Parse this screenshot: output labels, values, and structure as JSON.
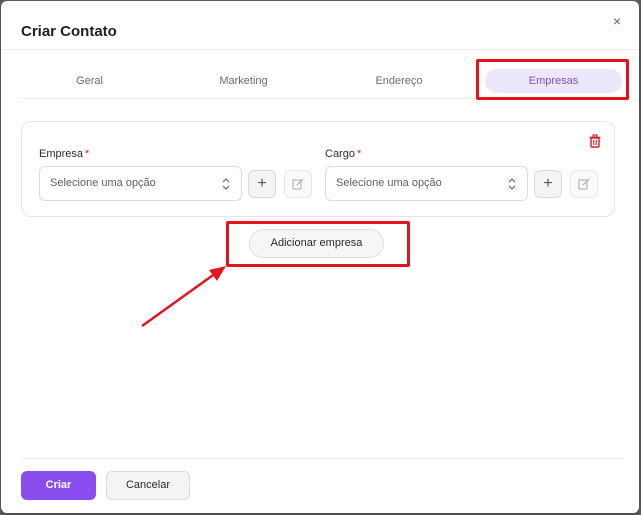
{
  "dialog": {
    "title": "Criar Contato",
    "close_symbol": "×"
  },
  "tabs": [
    {
      "label": "Geral",
      "active": false
    },
    {
      "label": "Marketing",
      "active": false
    },
    {
      "label": "Endereço",
      "active": false
    },
    {
      "label": "Empresas",
      "active": true
    }
  ],
  "company_card": {
    "empresa": {
      "label": "Empresa",
      "required_mark": "*",
      "placeholder": "Selecione uma opção"
    },
    "cargo": {
      "label": "Cargo",
      "required_mark": "*",
      "placeholder": "Selecione uma opção"
    },
    "add_symbol": "+",
    "icons": {
      "delete": "trash-icon",
      "edit": "edit-icon",
      "select": "chevron-up-down-icon"
    }
  },
  "add_company_label": "Adicionar empresa",
  "footer": {
    "primary_label": "Criar",
    "secondary_label": "Cancelar"
  },
  "colors": {
    "accent": "#8a4df0",
    "tab_active_bg": "#ede7fb",
    "tab_active_text": "#7a4fd8",
    "annotation_red": "#e3141e",
    "required_red": "#d4222a"
  }
}
